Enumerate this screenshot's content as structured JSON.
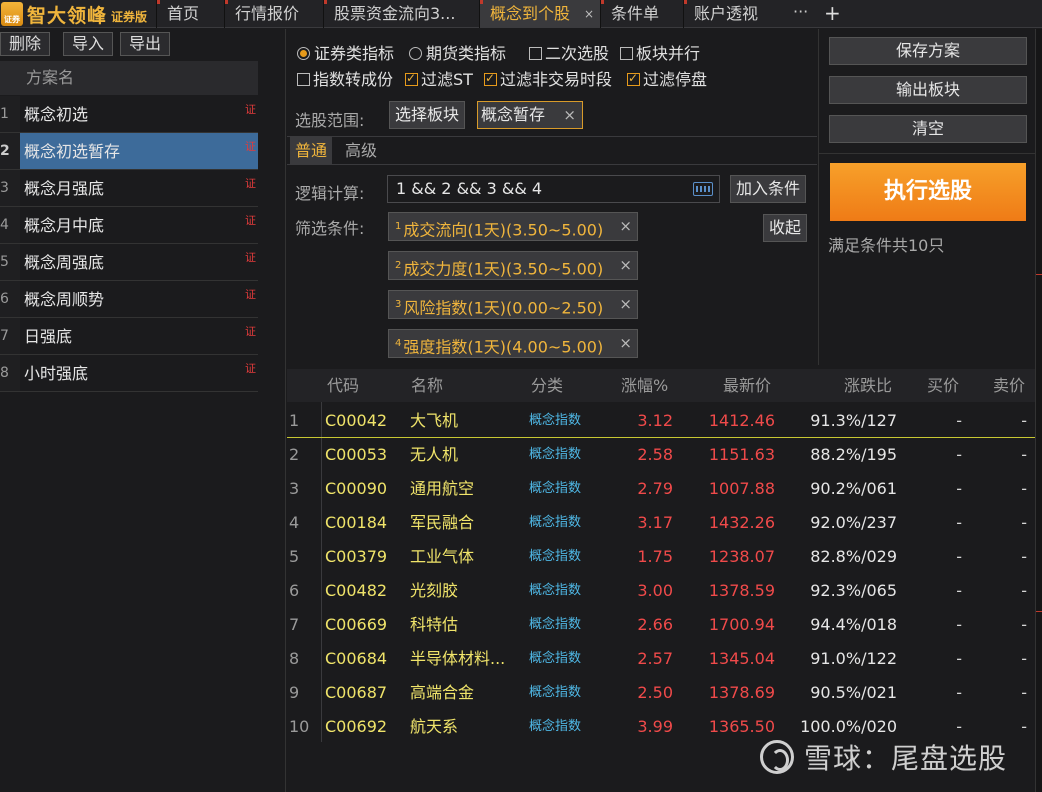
{
  "app": {
    "logo_text": "智大领峰",
    "edition": "证券版",
    "logo_badge": "证券"
  },
  "tabs": [
    {
      "label": "首页"
    },
    {
      "label": "行情报价"
    },
    {
      "label": "股票资金流向3..."
    },
    {
      "label": "概念到个股",
      "active": true,
      "close": "×"
    },
    {
      "label": "条件单"
    },
    {
      "label": "账户透视"
    }
  ],
  "tab_more": "···",
  "tab_add": "+",
  "left": {
    "buttons": {
      "delete": "删除",
      "import": "导入",
      "export": "导出"
    },
    "header": "方案名",
    "plans": [
      {
        "num": "1",
        "label": "概念初选",
        "tag": "证"
      },
      {
        "num": "2",
        "label": "概念初选暂存",
        "tag": "证",
        "selected": true
      },
      {
        "num": "3",
        "label": "概念月强底",
        "tag": "证"
      },
      {
        "num": "4",
        "label": "概念月中底",
        "tag": "证"
      },
      {
        "num": "5",
        "label": "概念周强底",
        "tag": "证"
      },
      {
        "num": "6",
        "label": "概念周顺势",
        "tag": "证"
      },
      {
        "num": "7",
        "label": "日强底",
        "tag": "证"
      },
      {
        "num": "8",
        "label": "小时强底",
        "tag": "证"
      }
    ]
  },
  "options": {
    "securities": "证券类指标",
    "futures": "期货类指标",
    "secondary": "二次选股",
    "sector_parallel": "板块并行",
    "index_to_components": "指数转成份",
    "filter_st": "过滤ST",
    "filter_nontrading": "过滤非交易时段",
    "filter_suspended": "过滤停盘"
  },
  "scope": {
    "label": "选股范围:",
    "select_button": "选择板块",
    "chip": "概念暂存",
    "chip_close": "×"
  },
  "subtabs": {
    "normal": "普通",
    "advanced": "高级"
  },
  "logic": {
    "label": "逻辑计算:",
    "value": "1 && 2 && 3 && 4",
    "add_button": "加入条件"
  },
  "filter": {
    "label": "筛选条件:",
    "collapse_button": "收起",
    "conditions": [
      {
        "num": "1",
        "text": "成交流向(1天)(3.50~5.00)"
      },
      {
        "num": "2",
        "text": "成交力度(1天)(3.50~5.00)"
      },
      {
        "num": "3",
        "text": "风险指数(1天)(0.00~2.50)"
      },
      {
        "num": "4",
        "text": "强度指数(1天)(4.00~5.00)"
      }
    ],
    "close": "×"
  },
  "right": {
    "save": "保存方案",
    "export_sector": "输出板块",
    "clear": "清空",
    "execute": "执行选股",
    "result_count": "满足条件共10只"
  },
  "table": {
    "headers": {
      "code": "代码",
      "name": "名称",
      "category": "分类",
      "change": "涨幅%",
      "price": "最新价",
      "ratio": "涨跌比",
      "bid": "买价",
      "ask": "卖价"
    },
    "rows": [
      {
        "idx": "1",
        "code": "C00042",
        "name": "大飞机",
        "cat": "概念指数",
        "chg": "3.12",
        "px": "1412.46",
        "ratio": "91.3%/127",
        "bid": "-",
        "ask": "-"
      },
      {
        "idx": "2",
        "code": "C00053",
        "name": "无人机",
        "cat": "概念指数",
        "chg": "2.58",
        "px": "1151.63",
        "ratio": "88.2%/195",
        "bid": "-",
        "ask": "-"
      },
      {
        "idx": "3",
        "code": "C00090",
        "name": "通用航空",
        "cat": "概念指数",
        "chg": "2.79",
        "px": "1007.88",
        "ratio": "90.2%/061",
        "bid": "-",
        "ask": "-"
      },
      {
        "idx": "4",
        "code": "C00184",
        "name": "军民融合",
        "cat": "概念指数",
        "chg": "3.17",
        "px": "1432.26",
        "ratio": "92.0%/237",
        "bid": "-",
        "ask": "-"
      },
      {
        "idx": "5",
        "code": "C00379",
        "name": "工业气体",
        "cat": "概念指数",
        "chg": "1.75",
        "px": "1238.07",
        "ratio": "82.8%/029",
        "bid": "-",
        "ask": "-"
      },
      {
        "idx": "6",
        "code": "C00482",
        "name": "光刻胶",
        "cat": "概念指数",
        "chg": "3.00",
        "px": "1378.59",
        "ratio": "92.3%/065",
        "bid": "-",
        "ask": "-"
      },
      {
        "idx": "7",
        "code": "C00669",
        "name": "科特估",
        "cat": "概念指数",
        "chg": "2.66",
        "px": "1700.94",
        "ratio": "94.4%/018",
        "bid": "-",
        "ask": "-"
      },
      {
        "idx": "8",
        "code": "C00684",
        "name": "半导体材料...",
        "cat": "概念指数",
        "chg": "2.57",
        "px": "1345.04",
        "ratio": "91.0%/122",
        "bid": "-",
        "ask": "-"
      },
      {
        "idx": "9",
        "code": "C00687",
        "name": "高端合金",
        "cat": "概念指数",
        "chg": "2.50",
        "px": "1378.69",
        "ratio": "90.5%/021",
        "bid": "-",
        "ask": "-"
      },
      {
        "idx": "10",
        "code": "C00692",
        "name": "航天系",
        "cat": "概念指数",
        "chg": "3.99",
        "px": "1365.50",
        "ratio": "100.0%/020",
        "bid": "-",
        "ask": "-"
      }
    ]
  },
  "watermark": "雪球：尾盘选股",
  "colors": {
    "accent": "#f0b53c",
    "up": "#f04a4a",
    "code": "#f0e46a",
    "category": "#4fb8e6",
    "selected_row": "#3d6b9a"
  }
}
